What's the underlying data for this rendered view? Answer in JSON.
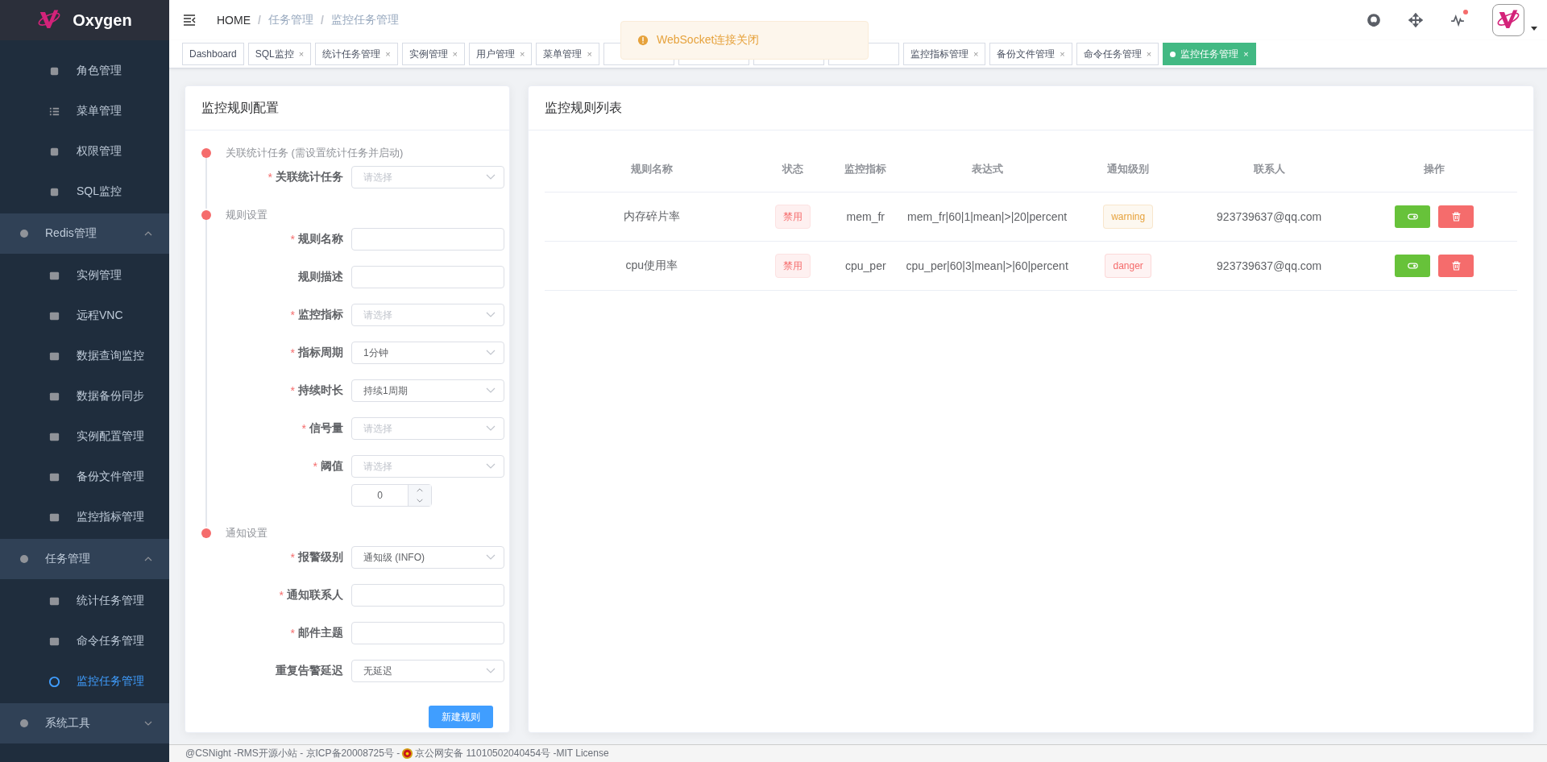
{
  "sidebar": {
    "logo": "Oxygen",
    "items": [
      {
        "label": "角色管理",
        "selected": false
      },
      {
        "label": "菜单管理",
        "selected": false
      },
      {
        "label": "权限管理",
        "selected": false
      },
      {
        "label": "SQL监控",
        "selected": false
      },
      {
        "label": "Redis管理",
        "expanded": true,
        "children": [
          {
            "label": "实例管理",
            "selected": false
          },
          {
            "label": "远程VNC",
            "selected": false
          },
          {
            "label": "数据查询监控",
            "selected": false
          },
          {
            "label": "数据备份同步",
            "selected": false
          },
          {
            "label": "实例配置管理",
            "selected": false
          },
          {
            "label": "备份文件管理",
            "selected": false
          },
          {
            "label": "监控指标管理",
            "selected": false
          }
        ]
      },
      {
        "label": "任务管理",
        "expanded": true,
        "children": [
          {
            "label": "统计任务管理",
            "selected": false
          },
          {
            "label": "命令任务管理",
            "selected": false
          },
          {
            "label": "监控任务管理",
            "selected": true
          }
        ]
      },
      {
        "label": "系统工具",
        "expanded": false
      }
    ]
  },
  "breadcrumb": [
    {
      "label": "HOME"
    },
    {
      "separator": "/",
      "label": "任务管理"
    },
    {
      "separator": "/",
      "label": "监控任务管理"
    }
  ],
  "notification": {
    "message": "WebSocket连接关闭"
  },
  "header_badge": {
    "unread": true
  },
  "tabs": [
    {
      "label": "Dashboard",
      "selected": false
    },
    {
      "label": "SQL监控",
      "close": "×",
      "selected": false
    },
    {
      "label": "统计任务管理",
      "close": "×",
      "selected": false
    },
    {
      "label": "实例管理",
      "close": "×",
      "selected": false
    },
    {
      "label": "用户管理",
      "close": "×",
      "selected": false
    },
    {
      "label": "菜单管理",
      "close": "×",
      "selected": false
    },
    {
      "selected": false
    },
    {
      "selected": false
    },
    {
      "selected": false
    },
    {
      "selected": false
    },
    {
      "label": "监控指标管理",
      "close": "×",
      "selected": false
    },
    {
      "label": "备份文件管理",
      "close": "×",
      "selected": false
    },
    {
      "label": "命令任务管理",
      "close": "×",
      "selected": false
    },
    {
      "label": "监控任务管理",
      "close": "×",
      "selected": true
    }
  ],
  "form_card": {
    "title": "监控规则配置",
    "steps": [
      {
        "title": "关联统计任务 (需设置统计任务并启动)",
        "fields": [
          {
            "label": "关联统计任务",
            "mark": "*",
            "kind": "select",
            "placeholder": "请选择"
          }
        ]
      },
      {
        "title": "规则设置",
        "fields": [
          {
            "label": "规则名称",
            "mark": "*",
            "kind": "input"
          },
          {
            "label": "规则描述",
            "kind": "input"
          },
          {
            "label": "监控指标",
            "mark": "*",
            "kind": "select",
            "placeholder": "请选择"
          },
          {
            "label": "指标周期",
            "mark": "*",
            "kind": "select",
            "value": "1分钟"
          },
          {
            "label": "持续时长",
            "mark": "*",
            "kind": "select",
            "value": "持续1周期"
          },
          {
            "label": "信号量",
            "mark": "*",
            "kind": "select",
            "placeholder": "请选择"
          },
          {
            "label": "阈值",
            "mark": "*",
            "kind": "select",
            "placeholder": "请选择",
            "number": "0"
          }
        ]
      },
      {
        "title": "通知设置",
        "fields": [
          {
            "label": "报警级别",
            "mark": "*",
            "kind": "select",
            "value": "通知级 (INFO)"
          },
          {
            "label": "通知联系人",
            "mark": "*",
            "kind": "input"
          },
          {
            "label": "邮件主题",
            "mark": "*",
            "kind": "input"
          },
          {
            "label": "重复告警延迟",
            "kind": "select",
            "value": "无延迟"
          }
        ]
      }
    ],
    "submit": "新建规则"
  },
  "list_card": {
    "title": "监控规则列表",
    "columns": [
      "规则名称",
      "状态",
      "监控指标",
      "表达式",
      "通知级别",
      "联系人",
      "操作"
    ],
    "rows": [
      {
        "name": "内存碎片率",
        "status": "禁用",
        "enabled": false,
        "metric": "mem_fr",
        "expression": "mem_fr|60|1|mean|>|20|percent",
        "level": "warning",
        "color": "#e6a23c",
        "contact": "923739637@qq.com"
      },
      {
        "name": "cpu使用率",
        "status": "禁用",
        "enabled": false,
        "metric": "cpu_per",
        "expression": "cpu_per|60|3|mean|>|60|percent",
        "level": "danger",
        "color": "#f56c6c",
        "contact": "923739637@qq.com"
      }
    ]
  },
  "footer": [
    "@CSNight -RMS开源小站 - 京ICP备20008725号 -",
    "京公网安备 11010502040454号 -MIT License"
  ]
}
